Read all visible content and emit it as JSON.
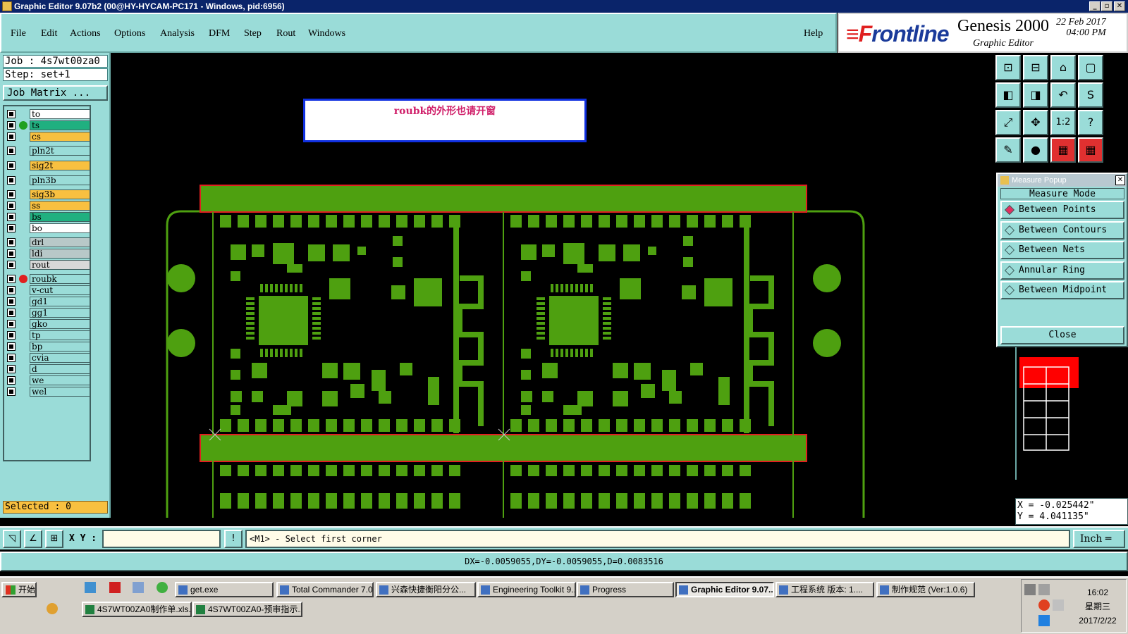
{
  "window": {
    "title": "Graphic Editor 9.07b2 (00@HY-HYCAM-PC171 - Windows, pid:6956)",
    "min": "_",
    "max": "▫",
    "close": "✕"
  },
  "menu": {
    "items": [
      "File",
      "Edit",
      "Actions",
      "Options",
      "Analysis",
      "DFM",
      "Step",
      "Rout",
      "Windows"
    ],
    "help": "Help"
  },
  "brand": {
    "logo_f": "≡F",
    "logo_rest": "rontline",
    "product": "Genesis 2000",
    "subtitle": "Graphic Editor",
    "date": "22 Feb 2017",
    "time": "04:00 PM"
  },
  "job": {
    "job_line": "Job : 4s7wt00za0",
    "step_line": "Step: set+1",
    "matrix_button": "Job Matrix ...",
    "selected": "Selected : 0"
  },
  "layers": [
    {
      "name": "to",
      "color": "#ffffff",
      "dot": ""
    },
    {
      "name": "ts",
      "color": "#20b080",
      "dot": "#20a020"
    },
    {
      "name": "cs",
      "color": "#f8c040",
      "dot": ""
    },
    {
      "name": "pln2t",
      "color": "#9adcd8",
      "dot": ""
    },
    {
      "name": "sig2t",
      "color": "#f8c040",
      "dot": ""
    },
    {
      "name": "pln3b",
      "color": "#9adcd8",
      "dot": ""
    },
    {
      "name": "sig3b",
      "color": "#f8c040",
      "dot": ""
    },
    {
      "name": "ss",
      "color": "#f8c040",
      "dot": ""
    },
    {
      "name": "bs",
      "color": "#20b080",
      "dot": ""
    },
    {
      "name": "bo",
      "color": "#ffffff",
      "dot": ""
    },
    {
      "name": "drl",
      "color": "#b8c8c8",
      "dot": ""
    },
    {
      "name": "ldi",
      "color": "#b8c8c8",
      "dot": ""
    },
    {
      "name": "rout",
      "color": "#d8d8d8",
      "dot": ""
    },
    {
      "name": "roubk",
      "color": "#9adcd8",
      "dot": "#e02020"
    },
    {
      "name": "v-cut",
      "color": "#9adcd8",
      "dot": ""
    },
    {
      "name": "gd1",
      "color": "#9adcd8",
      "dot": ""
    },
    {
      "name": "gg1",
      "color": "#9adcd8",
      "dot": ""
    },
    {
      "name": "gko",
      "color": "#9adcd8",
      "dot": ""
    },
    {
      "name": "tp",
      "color": "#9adcd8",
      "dot": ""
    },
    {
      "name": "bp",
      "color": "#9adcd8",
      "dot": ""
    },
    {
      "name": "cvia",
      "color": "#9adcd8",
      "dot": ""
    },
    {
      "name": "d",
      "color": "#9adcd8",
      "dot": ""
    },
    {
      "name": "we",
      "color": "#9adcd8",
      "dot": ""
    },
    {
      "name": "wel",
      "color": "#9adcd8",
      "dot": ""
    }
  ],
  "canvas": {
    "note": "roubk的外形也请开窗"
  },
  "toolbox": [
    {
      "icon": "zoom-in-icon",
      "glyph": "⊡"
    },
    {
      "icon": "zoom-out-icon",
      "glyph": "⊟"
    },
    {
      "icon": "home-icon",
      "glyph": "⌂"
    },
    {
      "icon": "window-icon",
      "glyph": "▢"
    },
    {
      "icon": "pan-left-icon",
      "glyph": "◧"
    },
    {
      "icon": "pan-right-icon",
      "glyph": "◨"
    },
    {
      "icon": "undo-icon",
      "glyph": "↶"
    },
    {
      "icon": "redraw-icon",
      "glyph": "S"
    },
    {
      "icon": "fit-icon",
      "glyph": "⤢"
    },
    {
      "icon": "center-icon",
      "glyph": "✥"
    },
    {
      "icon": "scale-icon",
      "glyph": "1:2"
    },
    {
      "icon": "help-icon",
      "glyph": "?"
    },
    {
      "icon": "measure-icon",
      "glyph": "✎"
    },
    {
      "icon": "snap-icon",
      "glyph": "●"
    },
    {
      "icon": "layers-icon",
      "glyph": "▦"
    },
    {
      "icon": "layers2-icon",
      "glyph": "▦"
    }
  ],
  "measure": {
    "title": "Measure Popup",
    "mode_label": "Measure Mode",
    "options": [
      "Between Points",
      "Between Contours",
      "Between Nets",
      "Annular Ring",
      "Between Midpoint"
    ],
    "selected": 0,
    "close": "Close"
  },
  "coords": {
    "x": "X = -0.025442\"",
    "y": "Y = 4.041135\""
  },
  "input": {
    "xy_label": "X Y :",
    "xy_value": "",
    "warn": "!",
    "prompt": "<M1> - Select first corner",
    "units": "Inch ═"
  },
  "status": {
    "text": "DX=-0.0059055,DY=-0.0059055,D=0.0083516"
  },
  "taskbar": {
    "start": "开始",
    "tasks_row1": [
      "get.exe",
      "Total Commander 7.0...",
      "兴森快捷衡阳分公...",
      "Engineering Toolkit 9....",
      "Progress",
      "Graphic Editor 9.07...",
      "工程系统  版本: 1....",
      "制作规范 (Ver:1.0.6)"
    ],
    "tasks_row2": [
      "4S7WT00ZA0制作单.xls...",
      "4S7WT00ZA0-预审指示..."
    ],
    "active_task": 5,
    "time": "16:02",
    "weekday": "星期三",
    "date": "2017/2/22"
  }
}
